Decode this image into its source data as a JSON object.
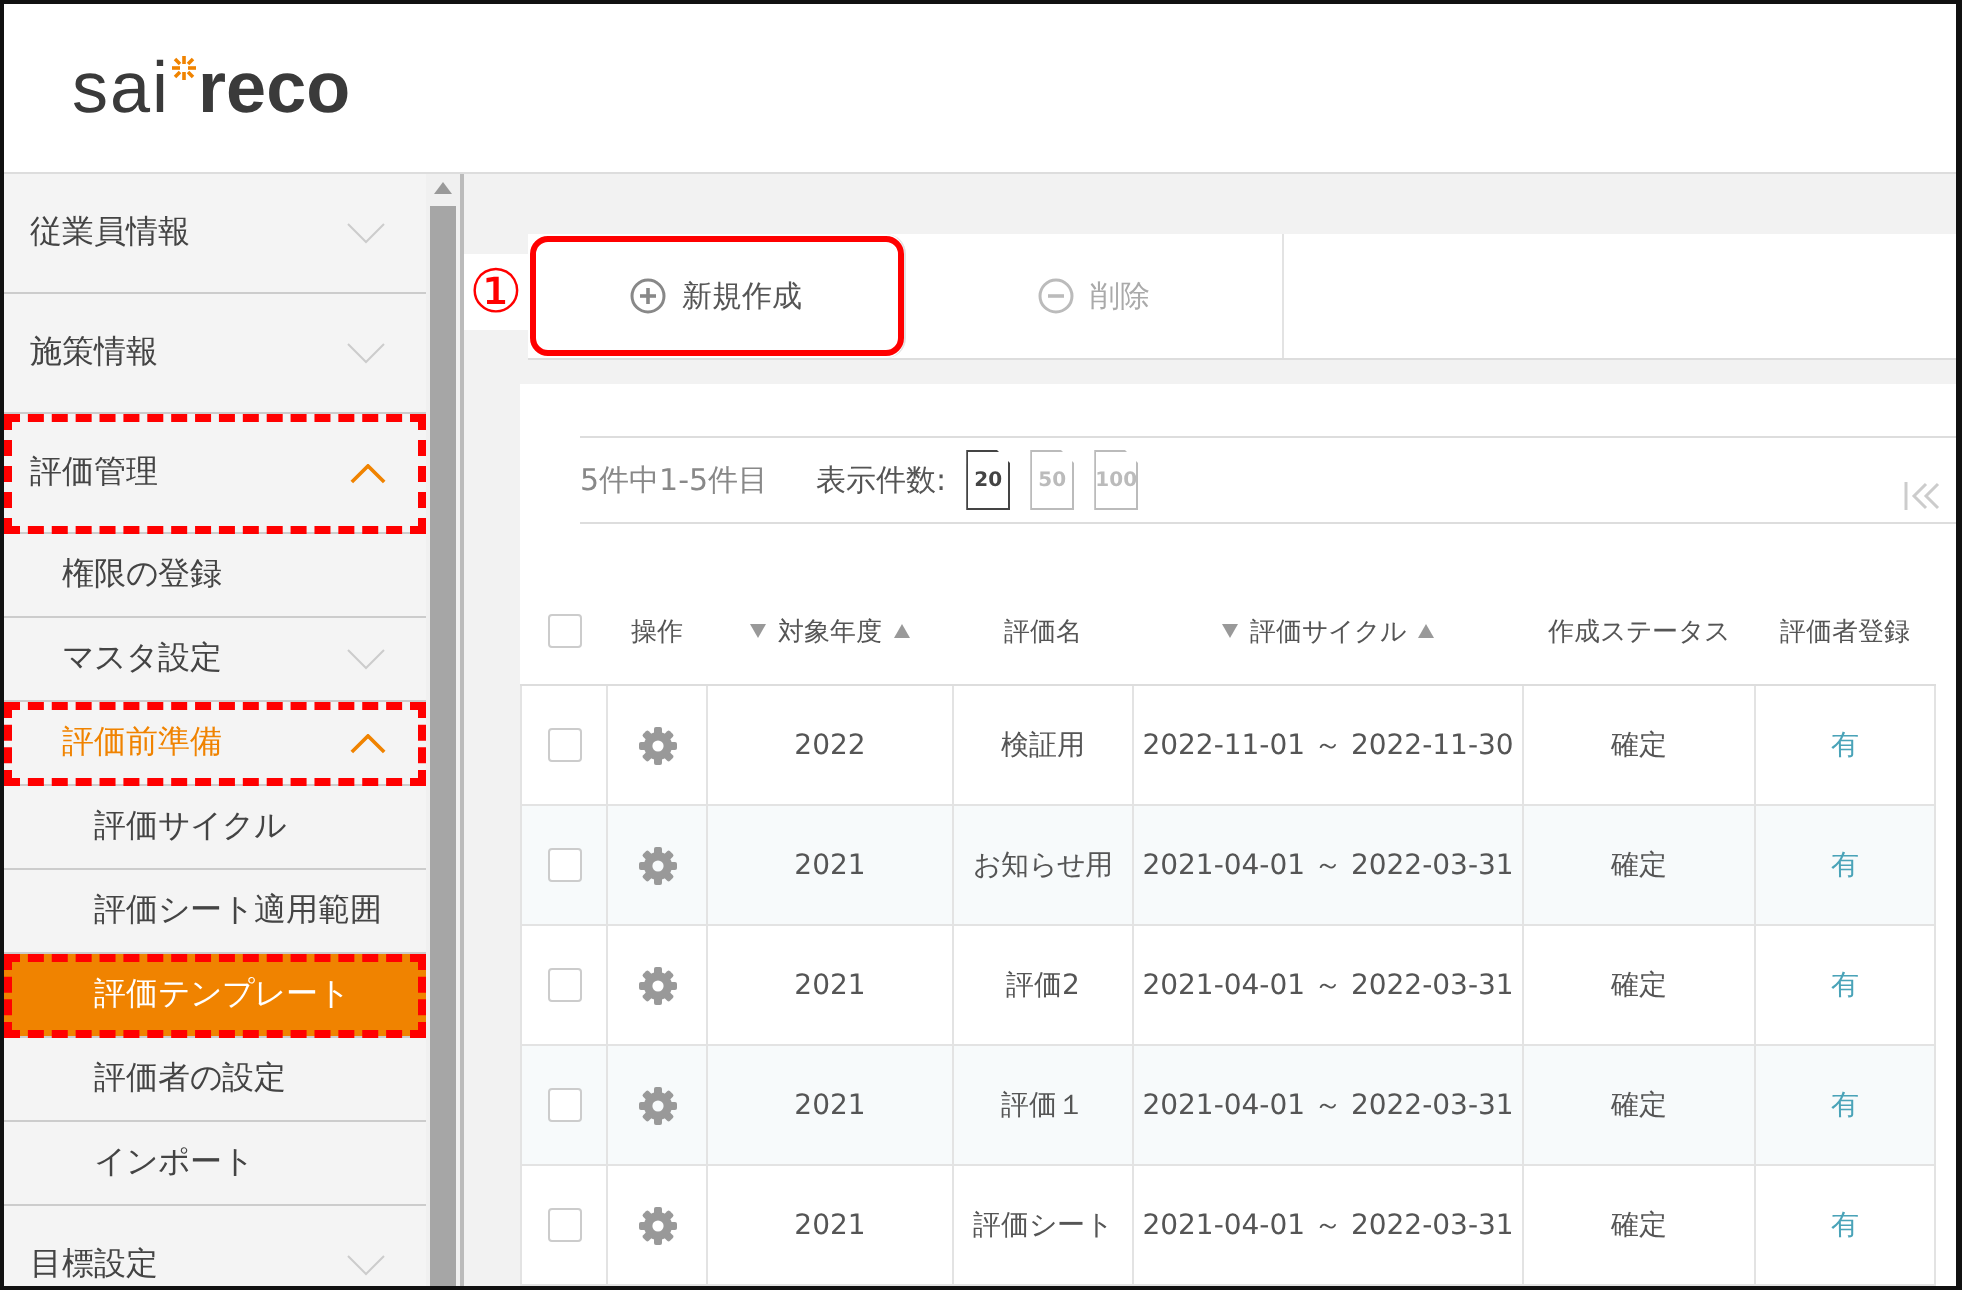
{
  "logo": {
    "light": "sai",
    "bold": "reco"
  },
  "sidebar": {
    "items": [
      {
        "label": "従業員情報",
        "kind": "group",
        "expanded": false,
        "annotated": false
      },
      {
        "label": "施策情報",
        "kind": "group",
        "expanded": false,
        "annotated": false
      },
      {
        "label": "評価管理",
        "kind": "group",
        "expanded": true,
        "annotated": true,
        "children": [
          {
            "label": "権限の登録",
            "kind": "link",
            "selected": false,
            "annotated": false
          },
          {
            "label": "マスタ設定",
            "kind": "group",
            "expanded": false,
            "annotated": false
          },
          {
            "label": "評価前準備",
            "kind": "group",
            "expanded": true,
            "annotated": true,
            "children": [
              {
                "label": "評価サイクル",
                "kind": "link",
                "selected": false,
                "annotated": false
              },
              {
                "label": "評価シート適用範囲",
                "kind": "link",
                "selected": false,
                "annotated": false
              },
              {
                "label": "評価テンプレート",
                "kind": "link",
                "selected": true,
                "annotated": true
              },
              {
                "label": "評価者の設定",
                "kind": "link",
                "selected": false,
                "annotated": false
              },
              {
                "label": "インポート",
                "kind": "link",
                "selected": false,
                "annotated": false
              }
            ]
          }
        ]
      },
      {
        "label": "目標設定",
        "kind": "group",
        "expanded": false,
        "annotated": false
      }
    ]
  },
  "callout": "①",
  "toolbar": [
    {
      "label": "新規作成",
      "kind": "add",
      "disabled": false,
      "annotated": true
    },
    {
      "label": "削除",
      "kind": "remove",
      "disabled": true,
      "annotated": false
    }
  ],
  "pager": {
    "summary": "5件中1-5件目",
    "size_label": "表示件数:",
    "sizes": [
      {
        "label": "20",
        "selected": true
      },
      {
        "label": "50",
        "selected": false
      },
      {
        "label": "100",
        "selected": false
      }
    ]
  },
  "table": {
    "select_all_checked": false,
    "columns": [
      {
        "label": "操作",
        "sortable": false
      },
      {
        "label": "対象年度",
        "sortable": true
      },
      {
        "label": "評価名",
        "sortable": false
      },
      {
        "label": "評価サイクル",
        "sortable": true
      },
      {
        "label": "作成ステータス",
        "sortable": false
      },
      {
        "label": "評価者登録",
        "sortable": false
      }
    ],
    "rows": [
      {
        "checked": false,
        "year": "2022",
        "name": "検証用",
        "cycle": "2022-11-01 ～ 2022-11-30",
        "status": "確定",
        "evaluator": "有"
      },
      {
        "checked": false,
        "year": "2021",
        "name": "お知らせ用",
        "cycle": "2021-04-01 ～ 2022-03-31",
        "status": "確定",
        "evaluator": "有"
      },
      {
        "checked": false,
        "year": "2021",
        "name": "評価2",
        "cycle": "2021-04-01 ～ 2022-03-31",
        "status": "確定",
        "evaluator": "有"
      },
      {
        "checked": false,
        "year": "2021",
        "name": "評価１",
        "cycle": "2021-04-01 ～ 2022-03-31",
        "status": "確定",
        "evaluator": "有"
      },
      {
        "checked": false,
        "year": "2021",
        "name": "評価シート",
        "cycle": "2021-04-01 ～ 2022-03-31",
        "status": "確定",
        "evaluator": "有"
      }
    ]
  }
}
